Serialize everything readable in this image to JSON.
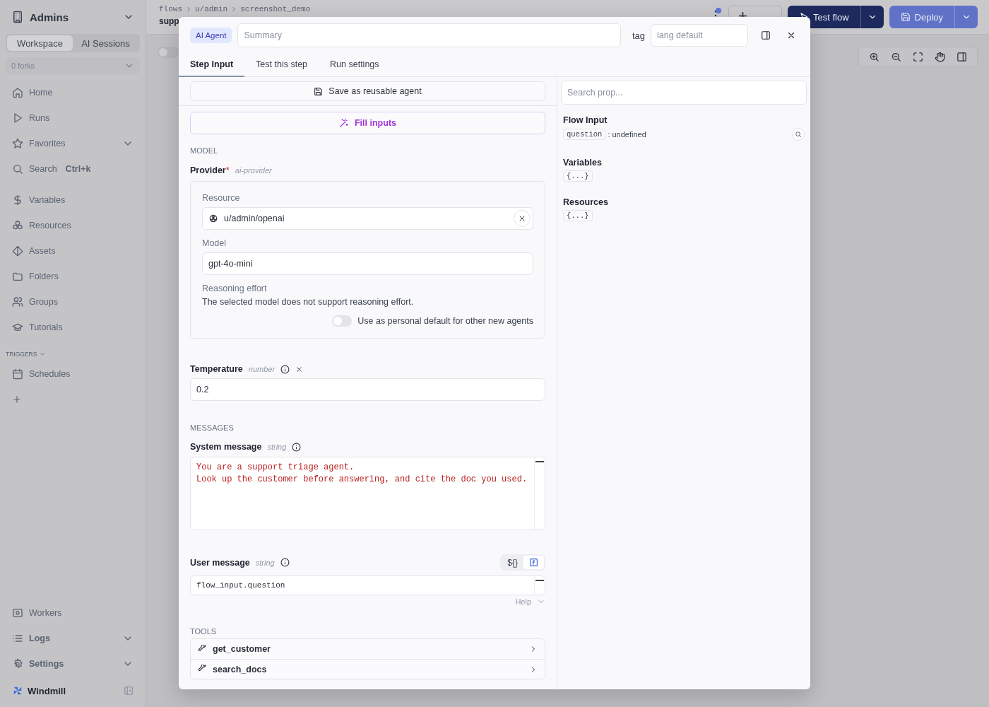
{
  "sidebar": {
    "workspace": "Admins",
    "modes": [
      {
        "label": "Workspace",
        "selected": true
      },
      {
        "label": "AI Sessions",
        "selected": false
      }
    ],
    "forks": "0 forks",
    "nav": [
      {
        "label": "Home",
        "kind": "link"
      },
      {
        "label": "Runs",
        "kind": "link"
      },
      {
        "label": "Favorites",
        "kind": "group"
      },
      {
        "label": "Search",
        "kind": "search",
        "shortcut": "Ctrl+k"
      }
    ],
    "resources_nav": [
      {
        "label": "Variables",
        "kind": "link"
      },
      {
        "label": "Resources",
        "kind": "link"
      },
      {
        "label": "Assets",
        "kind": "link"
      },
      {
        "label": "Folders",
        "kind": "link"
      },
      {
        "label": "Groups",
        "kind": "link"
      },
      {
        "label": "Tutorials",
        "kind": "link"
      }
    ],
    "triggers": {
      "title": "TRIGGERS",
      "items": [
        {
          "label": "Schedules",
          "kind": "link"
        }
      ]
    },
    "bottom_nav": [
      {
        "label": "Workers",
        "kind": "link"
      },
      {
        "label": "Logs",
        "kind": "group"
      },
      {
        "label": "Settings",
        "kind": "group"
      }
    ],
    "brand": "Windmill"
  },
  "top_bar": {
    "breadcrumb": [
      "flows",
      "u/admin",
      "screenshot_demo"
    ],
    "title": "supp",
    "test_button": "Test flow",
    "deploy_button": "Deploy"
  },
  "canvas": {
    "toggle": {
      "on": false
    }
  },
  "modal": {
    "badge": "AI Agent",
    "summary_placeholder": "Summary",
    "tag_label": "tag",
    "tag_placeholder": "lang default",
    "tabs": [
      {
        "label": "Step Input",
        "selected": true
      },
      {
        "label": "Test this step",
        "selected": false
      },
      {
        "label": "Run settings",
        "selected": false
      }
    ],
    "step_input": {
      "save_button": "Save as reusable agent",
      "fill_button": "Fill inputs",
      "model_section": {
        "title": "MODEL",
        "label": "Provider",
        "required_mark": "*",
        "type": "ai-provider",
        "resource_label": "Resource",
        "resource": "u/admin/openai",
        "model_label": "Model",
        "model": "gpt-4o-mini",
        "reasoning_label": "Reasoning effort",
        "reasoning_note": "The selected model does not support reasoning effort.",
        "default_toggle": {
          "label": "Use as personal default for other new agents",
          "on": false
        }
      },
      "temperature": {
        "label": "Temperature",
        "type": "number",
        "value": "0.2"
      },
      "messages_section": {
        "title": "MESSAGES",
        "system": {
          "label": "System message",
          "type": "string",
          "lines": [
            "You are a support triage agent.",
            "Look up the customer before answering, and cite the doc you used."
          ]
        },
        "user": {
          "label": "User message",
          "type": "string",
          "modes": [
            {
              "kind": "template",
              "label": "${}",
              "selected": false
            },
            {
              "kind": "function",
              "selected": true
            }
          ],
          "value": "flow_input.question",
          "help": "Help"
        }
      },
      "tools_section": {
        "title": "TOOLS",
        "tools": [
          "get_customer",
          "search_docs"
        ]
      }
    },
    "properties": {
      "search_placeholder": "Search prop...",
      "flow_input": {
        "title": "Flow Input",
        "props": [
          {
            "key": "question",
            "separator": ":",
            "value": "undefined"
          }
        ]
      },
      "variables": {
        "title": "Variables",
        "preview": "{...}"
      },
      "resources": {
        "title": "Resources",
        "preview": "{...}"
      }
    }
  }
}
